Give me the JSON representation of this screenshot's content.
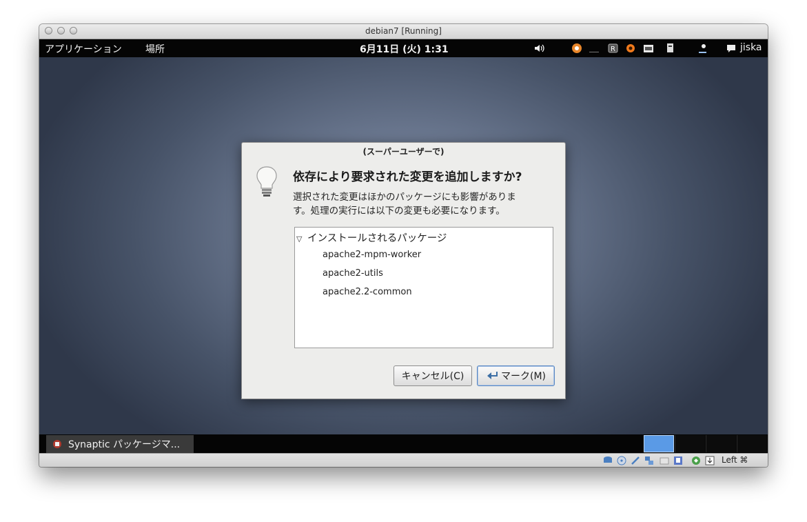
{
  "window": {
    "title": "debian7 [Running]"
  },
  "top_panel": {
    "menu_applications": "アプリケーション",
    "menu_places": "場所",
    "clock": "6月11日 (火) 1:31",
    "user": "jiska"
  },
  "dialog": {
    "title": "(スーパーユーザーで)",
    "heading": "依存により要求された変更を追加しますか?",
    "body_line1": "選択された変更はほかのパッケージにも影響がありま",
    "body_line2": "す。処理の実行には以下の変更も必要になります。",
    "tree_header": "インストールされるパッケージ",
    "packages": [
      "apache2-mpm-worker",
      "apache2-utils",
      "apache2.2-common"
    ],
    "cancel_label": "キャンセル(C)",
    "mark_label": "マーク(M)"
  },
  "taskbar": {
    "task_label": "Synaptic パッケージマ..."
  },
  "vbox_status": {
    "host_key": "Left ⌘"
  },
  "colors": {
    "panel": "#050505",
    "dialog_bg": "#ededeb",
    "workspace_active": "#5a9ae6"
  },
  "icons": [
    "volume-icon",
    "notification-icon",
    "keyboard-icon",
    "user-icon",
    "lightbulb-icon",
    "return-icon",
    "synaptic-icon"
  ]
}
